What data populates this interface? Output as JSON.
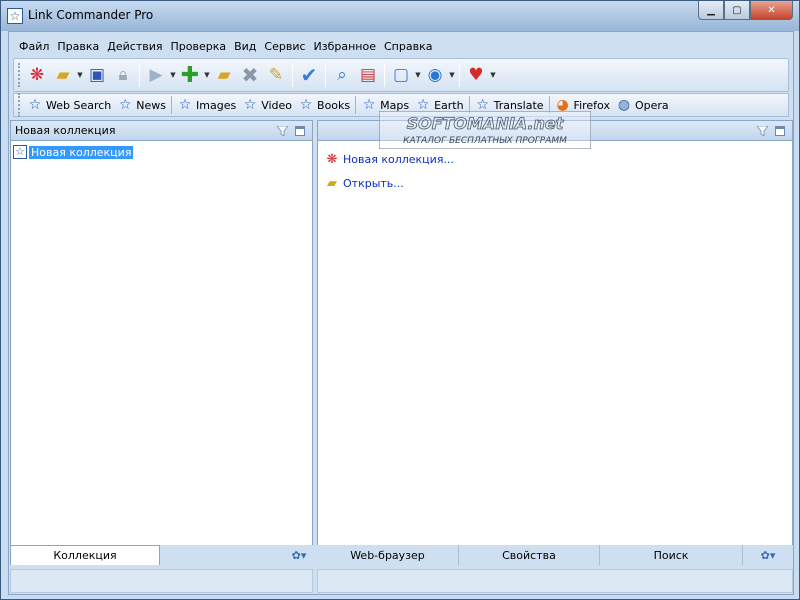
{
  "window": {
    "title": "Link Commander Pro"
  },
  "menu": [
    "Файл",
    "Правка",
    "Действия",
    "Проверка",
    "Вид",
    "Сервис",
    "Избранное",
    "Справка"
  ],
  "linkbar": [
    {
      "label": "Web Search",
      "icon": "star-icon"
    },
    {
      "label": "News",
      "icon": "star-icon"
    },
    {
      "label": "Images",
      "icon": "star-icon"
    },
    {
      "label": "Video",
      "icon": "star-icon"
    },
    {
      "label": "Books",
      "icon": "star-icon"
    },
    {
      "label": "Maps",
      "icon": "star-icon"
    },
    {
      "label": "Earth",
      "icon": "star-icon"
    },
    {
      "label": "Translate",
      "icon": "star-icon"
    },
    {
      "label": "Firefox",
      "icon": "firefox-icon"
    },
    {
      "label": "Opera",
      "icon": "opera-icon"
    }
  ],
  "left_pane": {
    "title": "Новая коллекция",
    "tree_item": "Новая коллекция",
    "tabs": {
      "active": "Коллекция"
    }
  },
  "right_pane": {
    "links": [
      "Новая коллекция...",
      "Открыть..."
    ],
    "tabs": [
      "Web-браузер",
      "Свойства",
      "Поиск"
    ]
  },
  "watermark": {
    "line1": "SOFTOMANIA.net",
    "line2": "КАТАЛОГ БЕСПЛАТНЫХ ПРОГРАММ"
  }
}
